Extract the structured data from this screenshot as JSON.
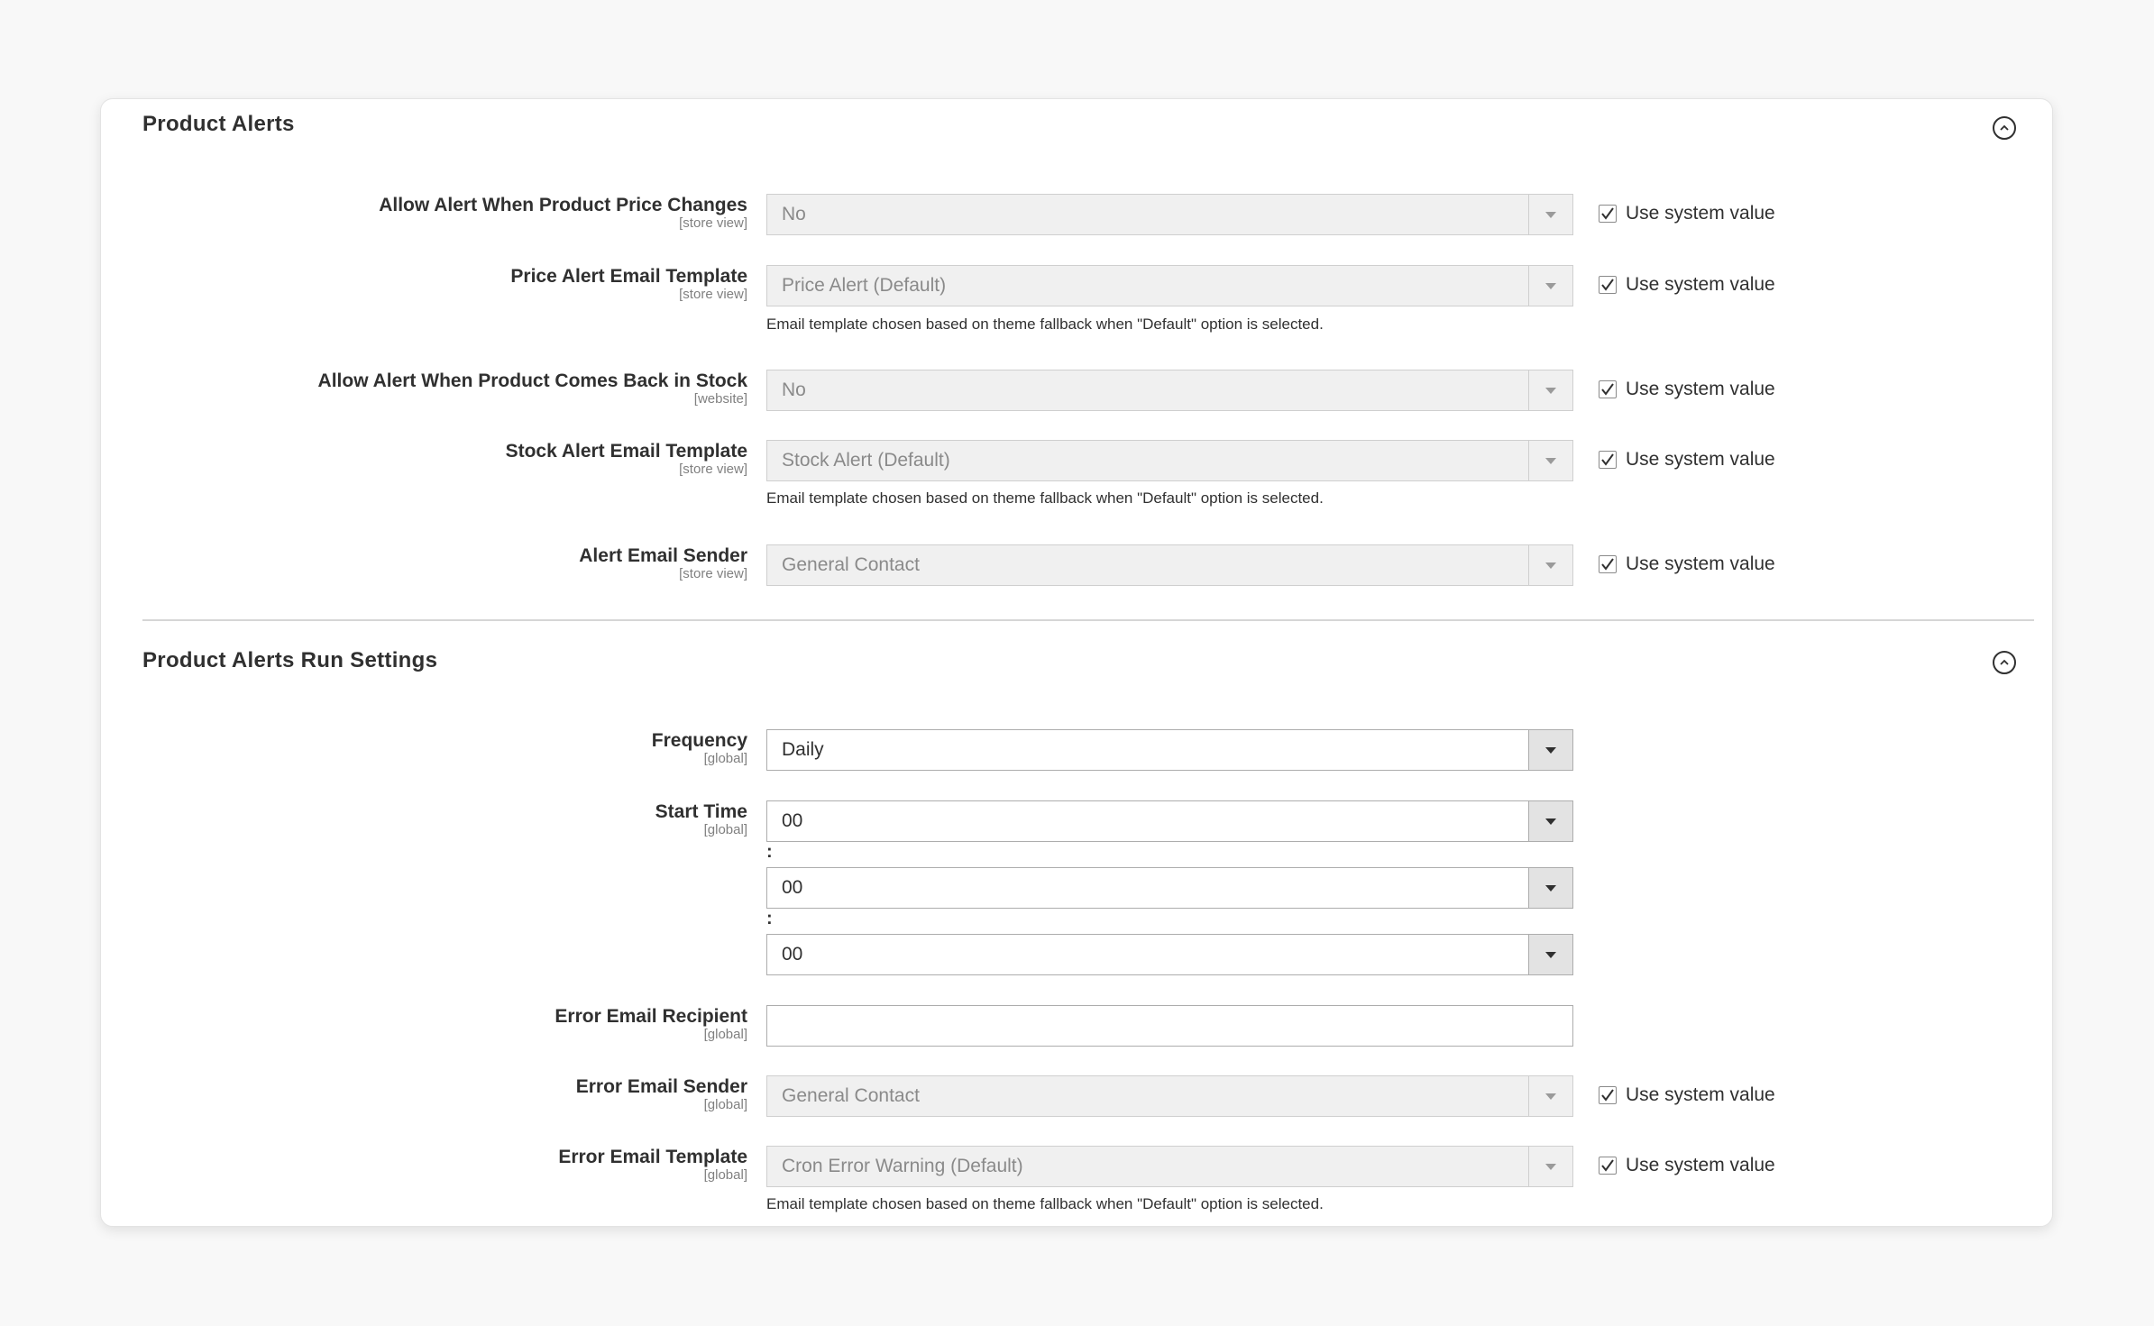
{
  "sections": {
    "alerts": {
      "title": "Product Alerts",
      "fields": {
        "price_change": {
          "label": "Allow Alert When Product Price Changes",
          "scope": "[store view]",
          "value": "No",
          "use_system": "Use system value"
        },
        "price_template": {
          "label": "Price Alert Email Template",
          "scope": "[store view]",
          "value": "Price Alert (Default)",
          "note": "Email template chosen based on theme fallback when \"Default\" option is selected.",
          "use_system": "Use system value"
        },
        "back_in_stock": {
          "label": "Allow Alert When Product Comes Back in Stock",
          "scope": "[website]",
          "value": "No",
          "use_system": "Use system value"
        },
        "stock_template": {
          "label": "Stock Alert Email Template",
          "scope": "[store view]",
          "value": "Stock Alert (Default)",
          "note": "Email template chosen based on theme fallback when \"Default\" option is selected.",
          "use_system": "Use system value"
        },
        "email_sender": {
          "label": "Alert Email Sender",
          "scope": "[store view]",
          "value": "General Contact",
          "use_system": "Use system value"
        }
      }
    },
    "run": {
      "title": "Product Alerts Run Settings",
      "fields": {
        "frequency": {
          "label": "Frequency",
          "scope": "[global]",
          "value": "Daily"
        },
        "start_time": {
          "label": "Start Time",
          "scope": "[global]",
          "hour": "00",
          "minute": "00",
          "second": "00",
          "separator": ":"
        },
        "error_recipient": {
          "label": "Error Email Recipient",
          "scope": "[global]",
          "value": ""
        },
        "error_sender": {
          "label": "Error Email Sender",
          "scope": "[global]",
          "value": "General Contact",
          "use_system": "Use system value"
        },
        "error_template": {
          "label": "Error Email Template",
          "scope": "[global]",
          "value": "Cron Error Warning (Default)",
          "note": "Email template chosen based on theme fallback when \"Default\" option is selected.",
          "use_system": "Use system value"
        }
      }
    }
  },
  "icons": {
    "collapse": "chevron-up-circle-icon",
    "check": "checkmark-icon",
    "dropdown": "triangle-down-icon"
  }
}
